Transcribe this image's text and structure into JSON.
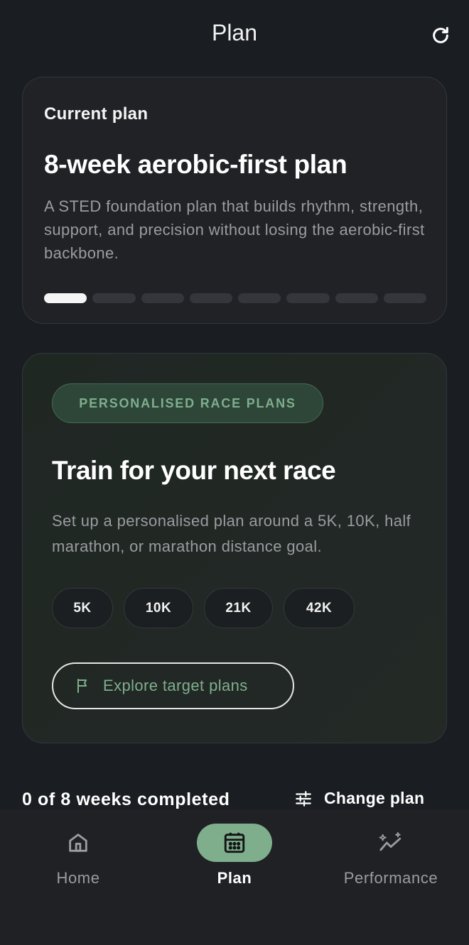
{
  "header": {
    "title": "Plan",
    "refresh_icon": "refresh-icon"
  },
  "current_plan": {
    "label": "Current plan",
    "title": "8-week aerobic-first plan",
    "description": "A STED foundation plan that builds rhythm, strength, support, and precision without losing the aerobic-first backbone.",
    "weeks_total": 8,
    "weeks_active_index": 1
  },
  "race": {
    "badge": "PERSONALISED RACE PLANS",
    "title": "Train for your next race",
    "description": "Set up a personalised plan around a 5K, 10K, half marathon, or marathon distance goal.",
    "chips": [
      "5K",
      "10K",
      "21K",
      "42K"
    ],
    "explore_label": "Explore target plans",
    "explore_icon": "flag-icon"
  },
  "footer": {
    "weeks_completed": "0 of 8 weeks completed",
    "change_plan_label": "Change plan",
    "change_plan_icon": "sliders-icon"
  },
  "tabs": [
    {
      "label": "Home",
      "icon": "home-icon",
      "active": false
    },
    {
      "label": "Plan",
      "icon": "calendar-icon",
      "active": true
    },
    {
      "label": "Performance",
      "icon": "trend-sparkle-icon",
      "active": false
    }
  ],
  "colors": {
    "background": "#1a1d21",
    "accent_green": "#7fae8d",
    "muted_text": "#9a9ca0",
    "card_border": "#33363b"
  }
}
